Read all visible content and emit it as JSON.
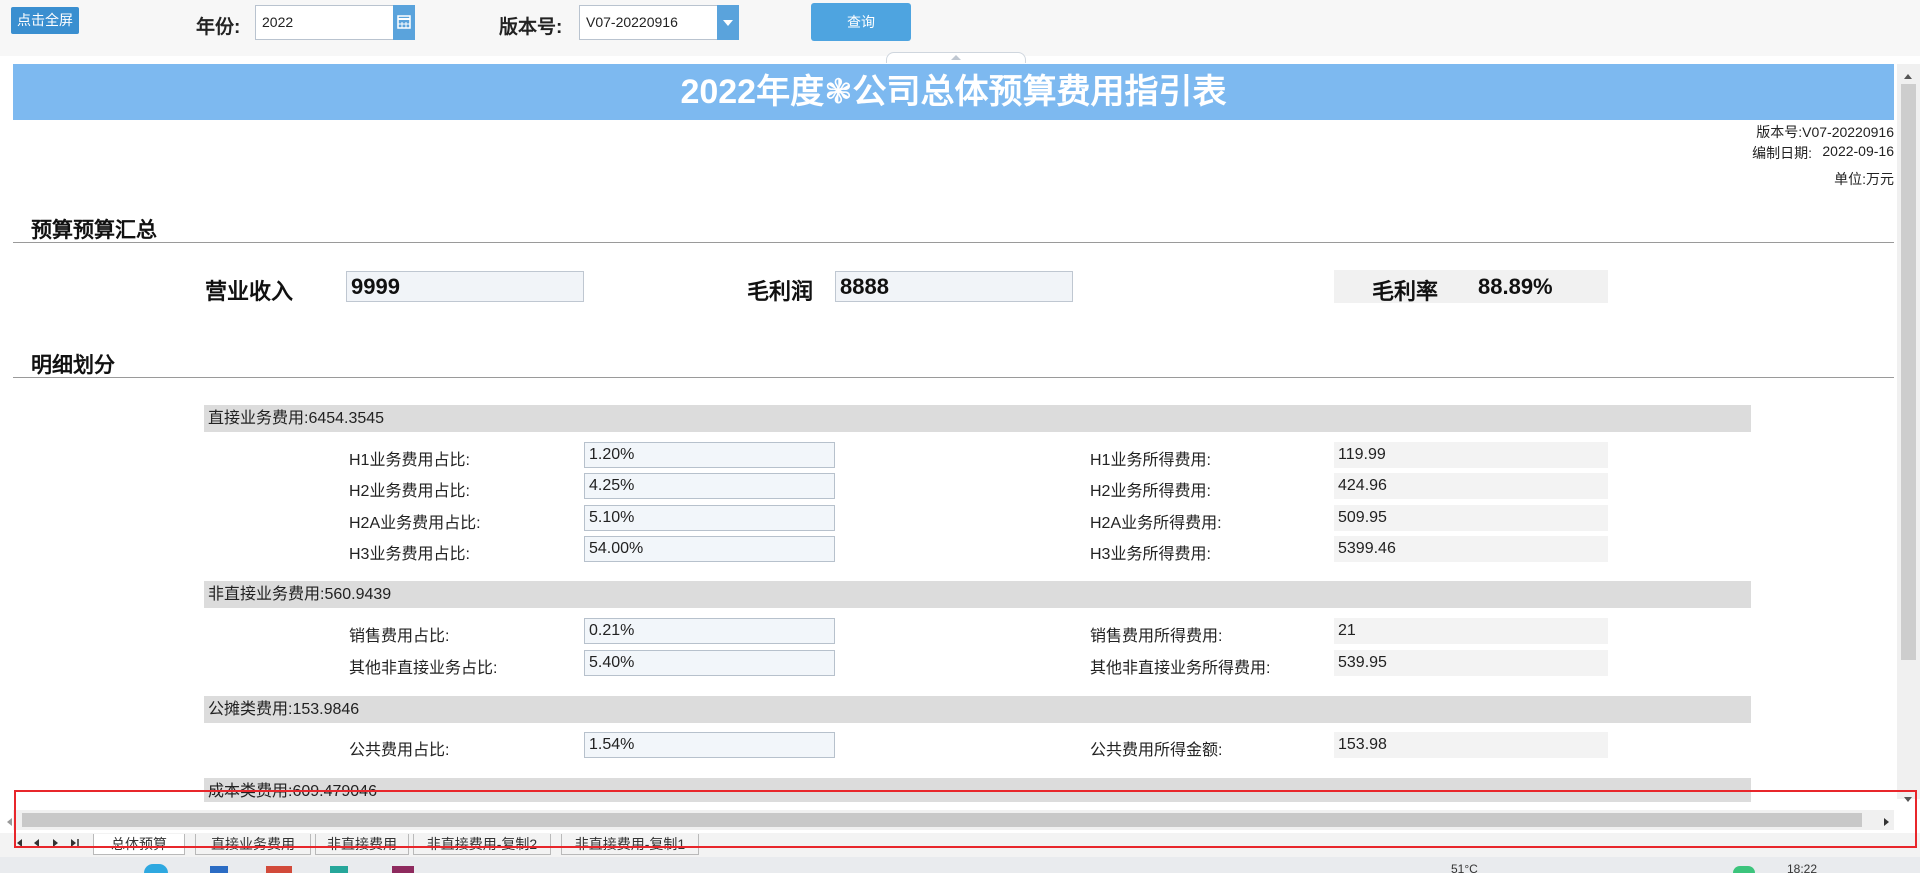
{
  "toolbar": {
    "fullscreen_label": "点击全屏",
    "year_label": "年份:",
    "year_value": "2022",
    "version_label": "版本号:",
    "version_value": "V07-20220916",
    "query_label": "查询"
  },
  "header": {
    "title": "2022年度❃公司总体预算费用指引表",
    "version_line": "版本号:V07-20220916",
    "date_label": "编制日期:",
    "date_value": "2022-09-16",
    "unit_line": "单位:万元"
  },
  "summary": {
    "section_title": "预算预算汇总",
    "revenue_label": "营业收入",
    "revenue_value": "9999",
    "gross_profit_label": "毛利润",
    "gross_profit_value": "8888",
    "gross_margin_label": "毛利率",
    "gross_margin_value": "88.89%"
  },
  "detail": {
    "section_title": "明细划分",
    "direct": {
      "header": "直接业务费用:6454.3545",
      "rows": [
        {
          "label": "H1业务费用占比:",
          "ratio": "1.20%",
          "out_label": "H1业务所得费用:",
          "out_value": "119.99"
        },
        {
          "label": "H2业务费用占比:",
          "ratio": "4.25%",
          "out_label": "H2业务所得费用:",
          "out_value": "424.96"
        },
        {
          "label": "H2A业务费用占比:",
          "ratio": "5.10%",
          "out_label": "H2A业务所得费用:",
          "out_value": "509.95"
        },
        {
          "label": "H3业务费用占比:",
          "ratio": "54.00%",
          "out_label": "H3业务所得费用:",
          "out_value": "5399.46"
        }
      ]
    },
    "indirect": {
      "header": "非直接业务费用:560.9439",
      "rows": [
        {
          "label": "销售费用占比:",
          "ratio": "0.21%",
          "out_label": "销售费用所得费用:",
          "out_value": "21"
        },
        {
          "label": "其他非直接业务占比:",
          "ratio": "5.40%",
          "out_label": "其他非直接业务所得费用:",
          "out_value": "539.95"
        }
      ]
    },
    "shared": {
      "header": "公摊类费用:153.9846",
      "rows": [
        {
          "label": "公共费用占比:",
          "ratio": "1.54%",
          "out_label": "公共费用所得金额:",
          "out_value": "153.98"
        }
      ]
    },
    "cost": {
      "header": "成本类费用:609.479046"
    }
  },
  "sheet_tabs": [
    "总体预算",
    "直接业务费用",
    "非直接费用",
    "非直接费用-复制2",
    "非直接费用-复制1"
  ],
  "taskbar": {
    "weather": "51°C",
    "time": "18:22"
  }
}
